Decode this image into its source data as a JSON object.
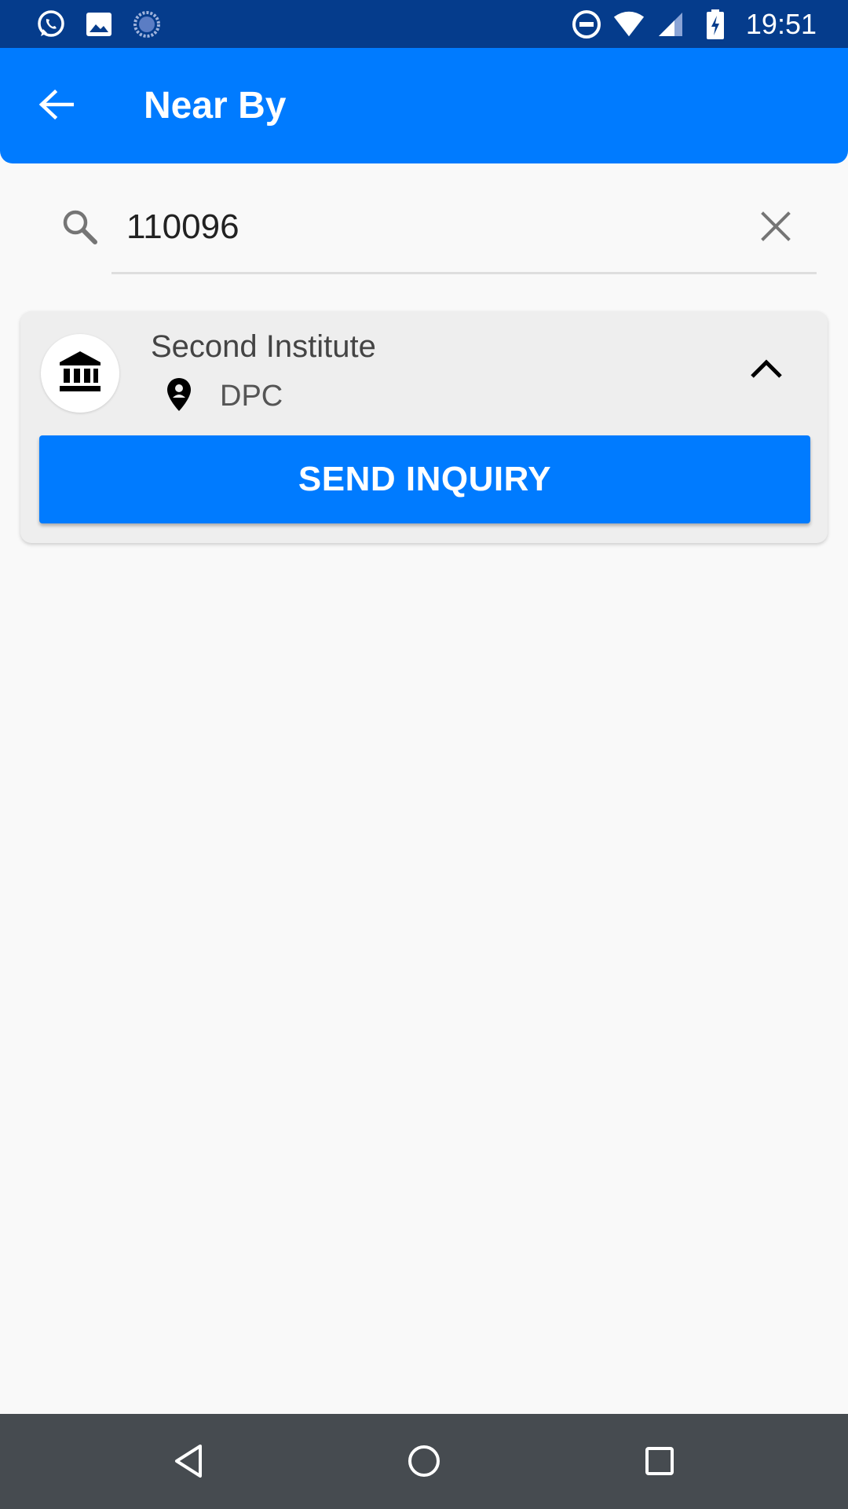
{
  "status_bar": {
    "time": "19:51",
    "left_icons": [
      "whatsapp-icon",
      "gallery-icon",
      "loading-icon"
    ],
    "right_icons": [
      "do-not-disturb-icon",
      "wifi-icon",
      "cell-signal-icon",
      "battery-charging-icon"
    ]
  },
  "app_bar": {
    "title": "Near By",
    "back_icon": "arrow-left-icon"
  },
  "search": {
    "value": "110096",
    "search_icon": "search-icon",
    "clear_icon": "close-icon"
  },
  "results": [
    {
      "name": "Second Institute",
      "location": "DPC",
      "avatar_icon": "institution-icon",
      "location_icon": "location-pin-icon",
      "expand_icon": "chevron-up-icon",
      "action_label": "SEND INQUIRY"
    }
  ],
  "nav_bar": {
    "icons": [
      "back-triangle-icon",
      "home-circle-icon",
      "recents-square-icon"
    ]
  },
  "colors": {
    "status_bar": "#053c8c",
    "primary": "#007bff",
    "background": "#f9f9f9",
    "card": "#eeeeee",
    "nav_bar": "#464b50"
  }
}
